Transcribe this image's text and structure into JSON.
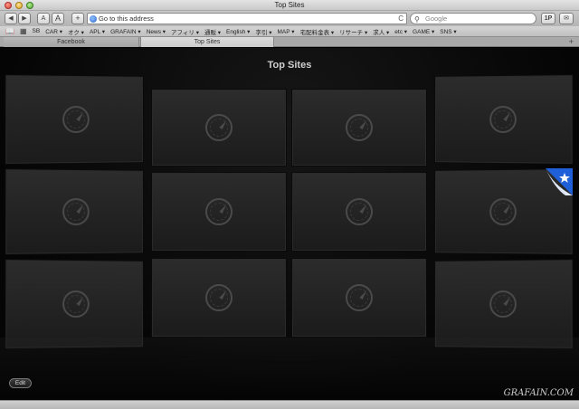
{
  "window": {
    "title": "Top Sites"
  },
  "toolbar": {
    "back_icon": "back-arrow-icon",
    "forward_icon": "forward-arrow-icon",
    "text_smaller": "A",
    "text_larger": "A",
    "add_bookmark": "+",
    "address_placeholder": "Go to this address",
    "reload_glyph": "C",
    "search_placeholder": "Google",
    "ext1": "1P",
    "ext2": "✉"
  },
  "bookmarks": [
    "SB",
    "CAR ▾",
    "オク ▾",
    "APL ▾",
    "GRAFAIN ▾",
    "News ▾",
    "アフィリ ▾",
    "通販 ▾",
    "English ▾",
    "字引 ▾",
    "MAP ▾",
    "宅配料金表 ▾",
    "リサーチ ▾",
    "求人 ▾",
    "etc ▾",
    "GAME ▾",
    "SNS ▾"
  ],
  "tabs": [
    {
      "label": "Facebook",
      "active": false
    },
    {
      "label": "Top Sites",
      "active": true
    }
  ],
  "new_tab_label": "+",
  "content": {
    "heading": "Top Sites",
    "edit_label": "Edit",
    "watermark": "GRAFAIN.COM",
    "thumbnail_icon": "safari-compass-icon",
    "starred_badge_icon": "star-corner-badge-icon"
  }
}
